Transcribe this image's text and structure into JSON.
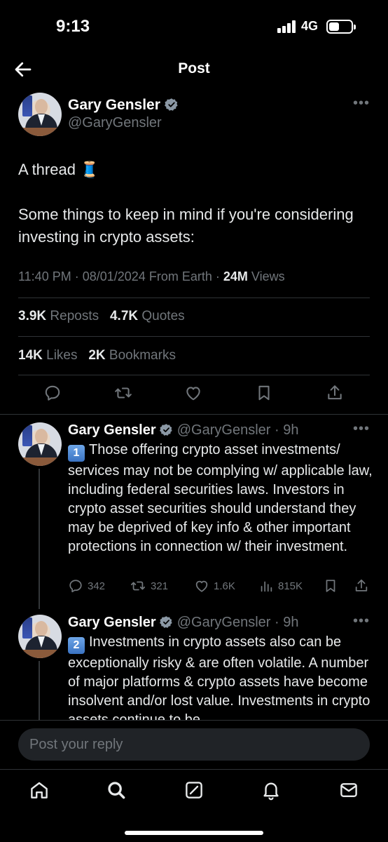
{
  "status_bar": {
    "time": "9:13",
    "network": "4G"
  },
  "header": {
    "title": "Post"
  },
  "main_post": {
    "name": "Gary Gensler",
    "handle": "@GaryGensler",
    "text_line1": "A thread 🧵",
    "text_line2": "Some things to keep in mind if you're considering investing in crypto assets:",
    "time": "11:40 PM",
    "date": "08/01/2024",
    "source": "From Earth",
    "views_count": "24M",
    "views_label": "Views",
    "reposts_count": "3.9K",
    "reposts_label": "Reposts",
    "quotes_count": "4.7K",
    "quotes_label": "Quotes",
    "likes_count": "14K",
    "likes_label": "Likes",
    "bookmarks_count": "2K",
    "bookmarks_label": "Bookmarks"
  },
  "replies": [
    {
      "name": "Gary Gensler",
      "handle": "@GaryGensler",
      "age": "9h",
      "number": "1",
      "text": "Those offering crypto asset investments/ services may not be complying w/ applicable law, including federal securities laws. Investors in crypto asset securities should understand they may be deprived of key info & other important protections in connection w/ their investment.",
      "replies": "342",
      "reposts": "321",
      "likes": "1.6K",
      "views": "815K"
    },
    {
      "name": "Gary Gensler",
      "handle": "@GaryGensler",
      "age": "9h",
      "number": "2",
      "text": "Investments in crypto assets also can be exceptionally risky & are often volatile. A number of major platforms & crypto assets have become insolvent and/or lost value. Investments in crypto assets continue to be"
    }
  ],
  "reply_box": {
    "placeholder": "Post your reply"
  },
  "icons": {
    "verified": "verified-badge-icon",
    "reply": "speech-bubble-icon",
    "repost": "repost-arrows-icon",
    "like": "heart-icon",
    "views": "bar-chart-icon",
    "bookmark": "bookmark-icon",
    "share": "share-icon"
  },
  "colors": {
    "background": "#000000",
    "text": "#e7e9ea",
    "muted": "#71767b",
    "verified": "#1d9bf0",
    "divider": "#2f3336"
  }
}
